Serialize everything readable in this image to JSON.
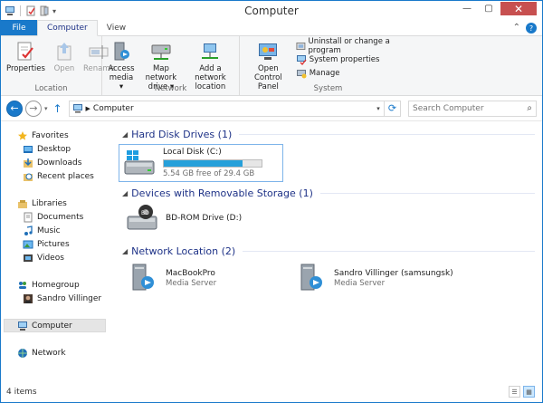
{
  "window": {
    "title": "Computer"
  },
  "tabs": [
    {
      "label": "File"
    },
    {
      "label": "Computer"
    },
    {
      "label": "View"
    }
  ],
  "ribbon": {
    "location": {
      "label": "Location",
      "properties": "Properties",
      "open": "Open",
      "rename": "Rename"
    },
    "network": {
      "label": "Network",
      "access_media": [
        "Access",
        "media ▾"
      ],
      "map_drive": [
        "Map network",
        "drive ▾"
      ],
      "add_location": [
        "Add a network",
        "location"
      ]
    },
    "system": {
      "label": "System",
      "control_panel": [
        "Open Control",
        "Panel"
      ],
      "uninstall": "Uninstall or change a program",
      "properties": "System properties",
      "manage": "Manage"
    }
  },
  "address": {
    "path": "Computer",
    "search_placeholder": "Search Computer"
  },
  "nav": {
    "favorites": "Favorites",
    "desktop": "Desktop",
    "downloads": "Downloads",
    "recent": "Recent places",
    "libraries": "Libraries",
    "documents": "Documents",
    "music": "Music",
    "pictures": "Pictures",
    "videos": "Videos",
    "homegroup": "Homegroup",
    "user": "Sandro Villinger",
    "computer": "Computer",
    "network": "Network"
  },
  "sections": {
    "hdd": "Hard Disk Drives (1)",
    "removable": "Devices with Removable Storage (1)",
    "network": "Network Location (2)"
  },
  "drives": {
    "local": {
      "name": "Local Disk (C:)",
      "free": "5.54 GB free of 29.4 GB",
      "used_fraction": 0.81
    },
    "bd": {
      "name": "BD-ROM Drive (D:)"
    }
  },
  "network_items": [
    {
      "name": "MacBookPro",
      "type": "Media Server"
    },
    {
      "name": "Sandro Villinger (samsungsk)",
      "type": "Media Server"
    }
  ],
  "status": {
    "count": "4 items"
  },
  "colors": {
    "accent": "#1979ca",
    "close": "#c75050",
    "bar": "#26a0da",
    "section": "#1e3287"
  }
}
